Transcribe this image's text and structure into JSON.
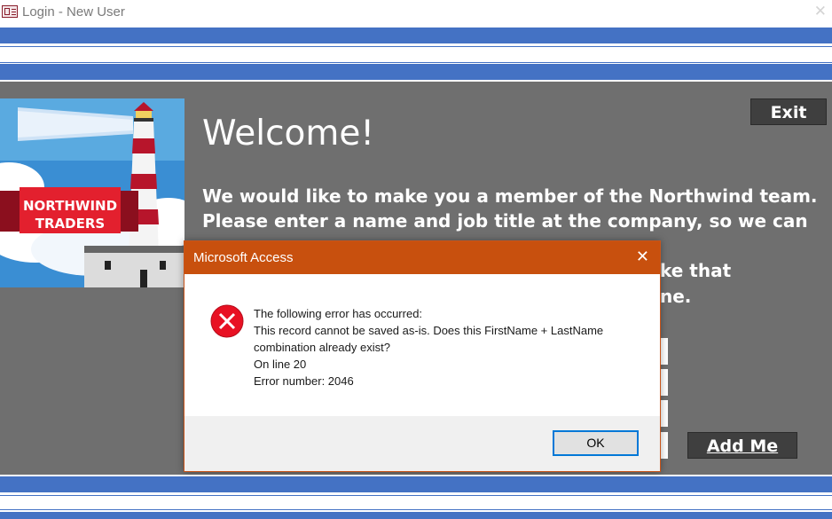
{
  "window": {
    "title": "Login - New User",
    "close_glyph": "✕",
    "icon": "form-icon"
  },
  "logo": {
    "line1": "NORTHWIND",
    "line2": "TRADERS"
  },
  "main": {
    "exit_label": "Exit",
    "welcome": "Welcome!",
    "intro_line1": "We would like to make you a member of the Northwind team.",
    "intro_line2": "Please enter a name and job title at the company, so we can",
    "intro_tail1": "ke that",
    "intro_tail2": "ne.",
    "add_me_label": "Add Me"
  },
  "dialog": {
    "title": "Microsoft Access",
    "close_glyph": "✕",
    "icon": "error-icon",
    "message_lines": [
      "The following error has occurred:",
      "This record cannot be saved as-is. Does this FirstName + LastName",
      "combination already exist?",
      "On line 20",
      "Error number: 2046"
    ],
    "ok_label": "OK"
  },
  "colors": {
    "band_blue": "#4472c4",
    "panel_gray": "#6f6f6f",
    "button_dark": "#3f3f3f",
    "dialog_title_orange": "#c8500e",
    "error_red": "#e81123",
    "logo_ribbon_red": "#e3202e"
  }
}
